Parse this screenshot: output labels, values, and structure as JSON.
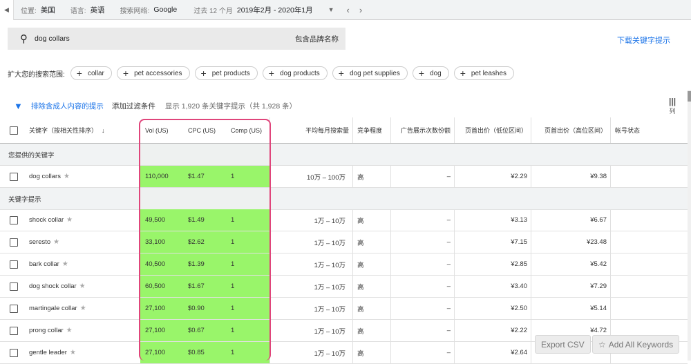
{
  "topbar": {
    "location_label": "位置:",
    "location": "美国",
    "language_label": "语言:",
    "language": "英语",
    "network_label": "搜索网络:",
    "network": "Google",
    "period_label": "过去 12 个月",
    "period": "2019年2月 - 2020年1月"
  },
  "search": {
    "value": "dog collars",
    "brand_toggle": "包含品牌名称"
  },
  "download": "下载关键字提示",
  "broaden": {
    "label": "扩大您的搜索范围:",
    "chips": [
      "collar",
      "pet accessories",
      "pet products",
      "dog products",
      "dog pet supplies",
      "dog",
      "pet leashes"
    ]
  },
  "filter": {
    "exclude_adult": "排除含成人内容的提示",
    "add_filter": "添加过滤条件",
    "count": "显示 1,920 条关键字提示（共 1,928 条）"
  },
  "columns_label": "列",
  "headers": [
    "关键字（按相关性排序）",
    "Vol (US)",
    "CPC (US)",
    "Comp (US)",
    "平均每月搜索量",
    "竞争程度",
    "广告展示次数份额",
    "页首出价（低位区间）",
    "页首出价（高位区间）",
    "帐号状态"
  ],
  "sections": {
    "provided": "您提供的关键字",
    "ideas": "关键字提示"
  },
  "provided_rows": [
    {
      "kw": "dog collars",
      "vol": "110,000",
      "cpc": "$1.47",
      "comp": "1",
      "avg": "10万 – 100万",
      "level": "高",
      "share": "–",
      "low": "¥2.29",
      "high": "¥9.38"
    }
  ],
  "idea_rows": [
    {
      "kw": "shock collar",
      "vol": "49,500",
      "cpc": "$1.49",
      "comp": "1",
      "avg": "1万 – 10万",
      "level": "高",
      "share": "–",
      "low": "¥3.13",
      "high": "¥6.67"
    },
    {
      "kw": "seresto",
      "vol": "33,100",
      "cpc": "$2.62",
      "comp": "1",
      "avg": "1万 – 10万",
      "level": "高",
      "share": "–",
      "low": "¥7.15",
      "high": "¥23.48"
    },
    {
      "kw": "bark collar",
      "vol": "40,500",
      "cpc": "$1.39",
      "comp": "1",
      "avg": "1万 – 10万",
      "level": "高",
      "share": "–",
      "low": "¥2.85",
      "high": "¥5.42"
    },
    {
      "kw": "dog shock collar",
      "vol": "60,500",
      "cpc": "$1.67",
      "comp": "1",
      "avg": "1万 – 10万",
      "level": "高",
      "share": "–",
      "low": "¥3.40",
      "high": "¥7.29"
    },
    {
      "kw": "martingale collar",
      "vol": "27,100",
      "cpc": "$0.90",
      "comp": "1",
      "avg": "1万 – 10万",
      "level": "高",
      "share": "–",
      "low": "¥2.50",
      "high": "¥5.14"
    },
    {
      "kw": "prong collar",
      "vol": "27,100",
      "cpc": "$0.67",
      "comp": "1",
      "avg": "1万 – 10万",
      "level": "高",
      "share": "–",
      "low": "¥2.22",
      "high": "¥4.72"
    },
    {
      "kw": "gentle leader",
      "vol": "27,100",
      "cpc": "$0.85",
      "comp": "1",
      "avg": "1万 – 10万",
      "level": "高",
      "share": "–",
      "low": "¥2.64",
      "high": ""
    }
  ],
  "buttons": {
    "export": "Export CSV",
    "add_all": "Add All Keywords"
  },
  "colors": {
    "highlight": "#99f56a",
    "box": "#e0457b",
    "link": "#1a73e8"
  }
}
